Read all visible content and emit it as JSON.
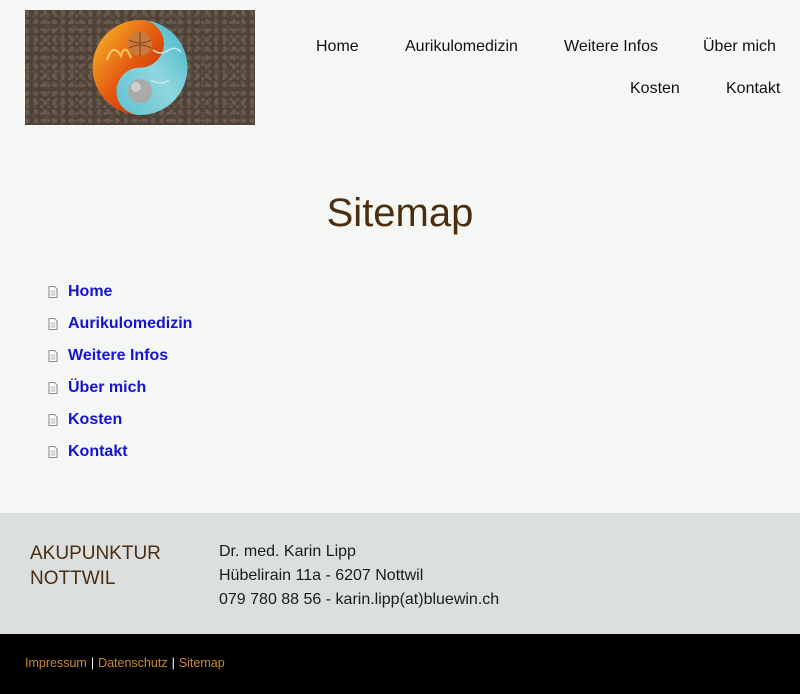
{
  "header": {
    "logo_alt": "Yin-Yang Logo",
    "nav": [
      "Home",
      "Aurikulomedizin",
      "Weitere Infos",
      "Über mich",
      "Kosten",
      "Kontakt"
    ]
  },
  "main": {
    "title": "Sitemap",
    "links": [
      "Home",
      "Aurikulomedizin",
      "Weitere Infos",
      "Über mich",
      "Kosten",
      "Kontakt"
    ]
  },
  "footer": {
    "brand_line1": "AKUPUNKTUR",
    "brand_line2": "NOTTWIL",
    "contact_name": "Dr. med. Karin Lipp",
    "contact_address": "Hübelirain 11a - 6207 Nottwil",
    "contact_phone_email": "079 780 88 56 - karin.lipp(at)bluewin.ch",
    "legal": [
      "Impressum",
      "Datenschutz",
      "Sitemap"
    ],
    "legal_separator": "|"
  },
  "colors": {
    "title": "#4a2e0e",
    "link": "#1414cc",
    "legal_link": "#c98a2e",
    "footer_top_bg": "#dcdfdf",
    "footer_bottom_bg": "#000000"
  }
}
